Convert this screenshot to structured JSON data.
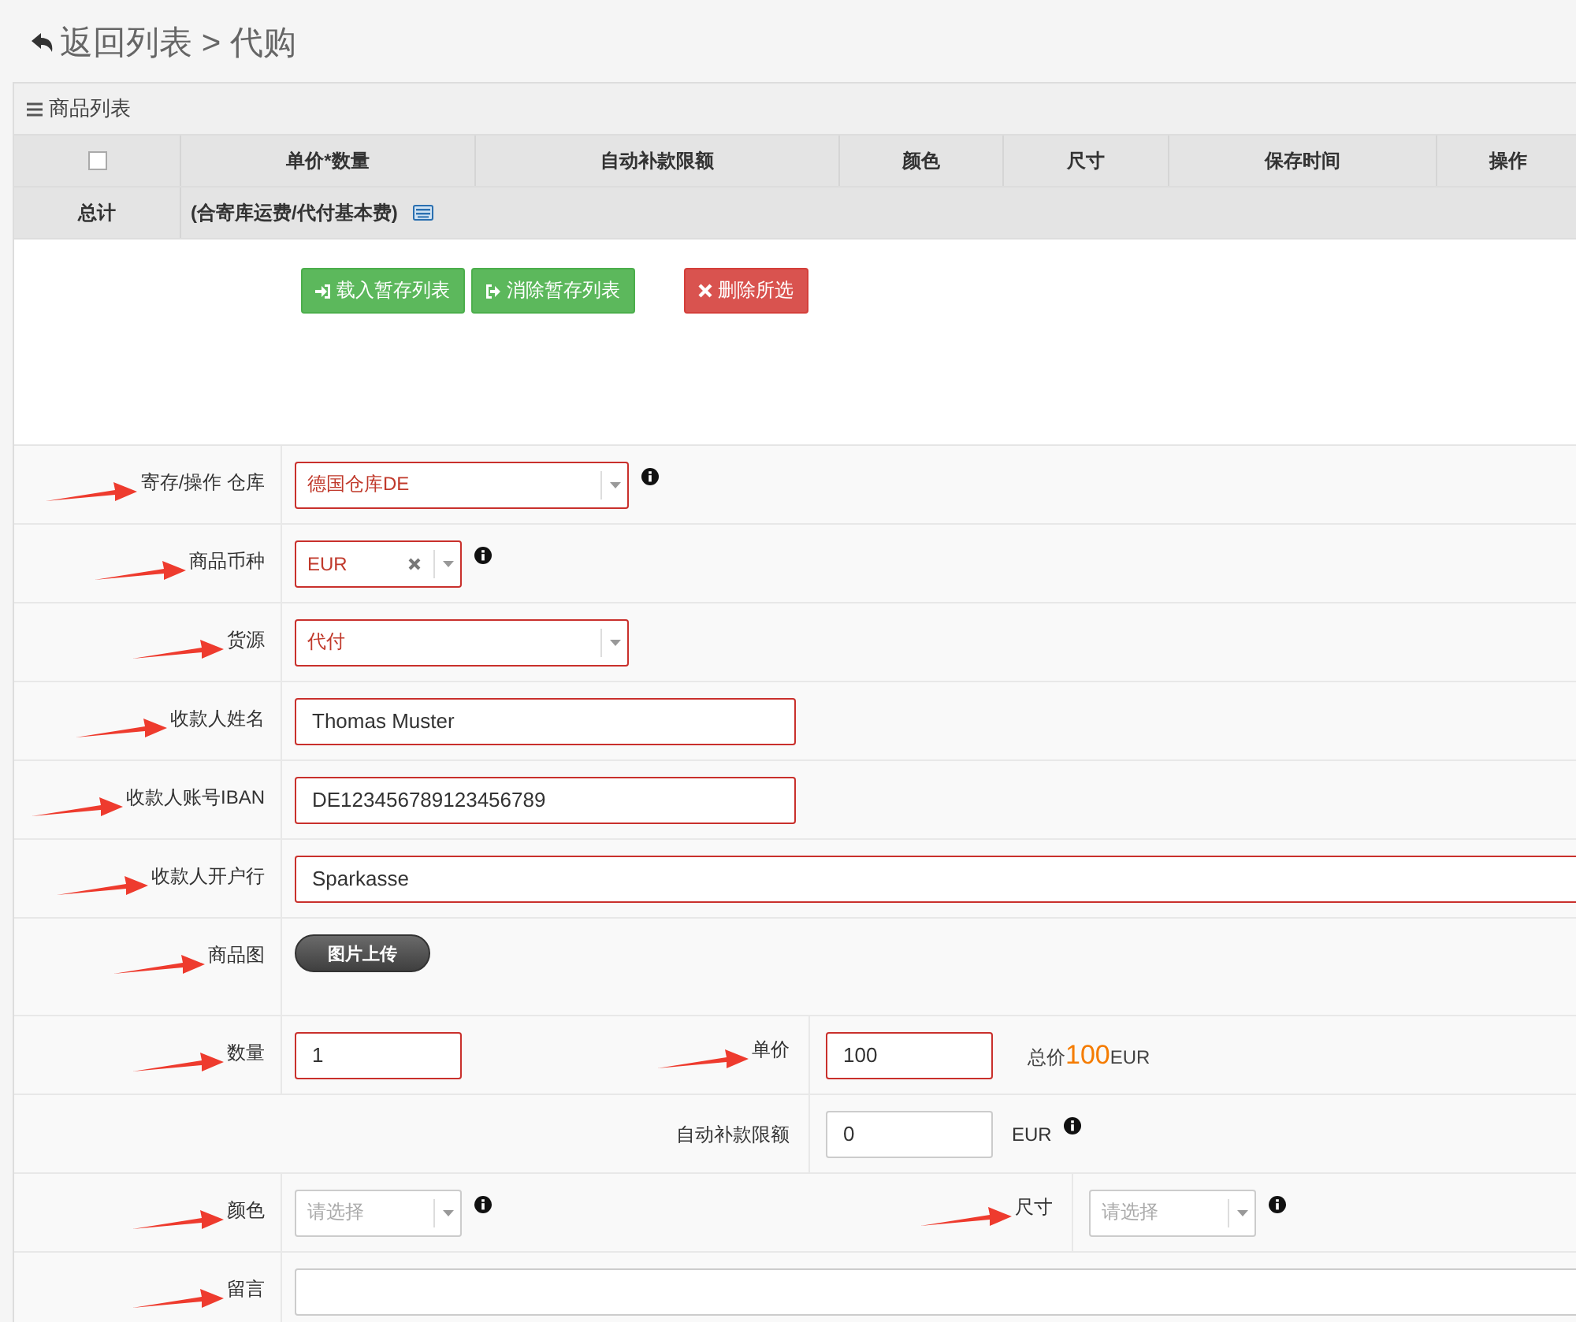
{
  "breadcrumb": {
    "text": "返回列表 > 代购"
  },
  "panel": {
    "title": "商品列表"
  },
  "table": {
    "select_all": {
      "checked": false
    },
    "columns": [
      "单价*数量",
      "自动补款限额",
      "颜色",
      "尺寸",
      "保存时间",
      "操作"
    ],
    "summary": {
      "label": "总计",
      "note": "(合寄库运费/代付基本费)"
    }
  },
  "buttons": [
    {
      "label": "载入暂存列表",
      "kind": "success"
    },
    {
      "label": "消除暂存列表",
      "kind": "success"
    },
    {
      "label": "删除所选",
      "kind": "danger"
    }
  ],
  "form": [
    {
      "kind": "field",
      "label": "寄存/操作 仓库",
      "annotated": true,
      "control": {
        "kind": "select",
        "value": "德国仓库DE",
        "error": true,
        "info": true,
        "clearable": false
      }
    },
    {
      "kind": "field",
      "label": "商品币种",
      "annotated": true,
      "control": {
        "kind": "select",
        "value": "EUR",
        "error": true,
        "info": true,
        "clearable": true
      }
    },
    {
      "kind": "field",
      "label": "货源",
      "annotated": true,
      "control": {
        "kind": "select",
        "value": "代付",
        "error": true,
        "info": false,
        "clearable": false
      }
    },
    {
      "kind": "field",
      "label": "收款人姓名",
      "annotated": true,
      "control": {
        "kind": "input",
        "value": "Thomas Muster",
        "error": true
      }
    },
    {
      "kind": "field",
      "label": "收款人账号IBAN",
      "annotated": true,
      "control": {
        "kind": "input",
        "value": "DE123456789123456789",
        "error": true
      }
    },
    {
      "kind": "field",
      "label": "收款人开户行",
      "annotated": true,
      "control": {
        "kind": "input",
        "value": "Sparkasse",
        "error": true
      }
    },
    {
      "kind": "upload",
      "label": "商品图",
      "annotated": true,
      "control": {
        "kind": "button",
        "value": "图片上传"
      }
    },
    {
      "kind": "pair",
      "label": "数量",
      "annotated": true,
      "control": {
        "kind": "input",
        "value": "1",
        "error": true
      },
      "label2": "单价",
      "annotated2": true,
      "control2": {
        "kind": "input",
        "value": "100",
        "error": true
      },
      "total": {
        "label": "总价",
        "amount": "100",
        "currency": "EUR"
      }
    },
    {
      "kind": "offset",
      "label": "自动补款限额",
      "annotated": false,
      "control": {
        "kind": "input",
        "value": "0",
        "error": false
      },
      "suffix": "EUR",
      "info": true
    },
    {
      "kind": "pair_select",
      "label": "颜色",
      "annotated": true,
      "control": {
        "kind": "select",
        "placeholder": "请选择",
        "error": false,
        "info": true,
        "clearable": false
      },
      "label2": "尺寸",
      "annotated2": true,
      "control2": {
        "kind": "select",
        "placeholder": "请选择",
        "error": false,
        "info": true,
        "clearable": false
      }
    },
    {
      "kind": "field",
      "label": "留言",
      "annotated": true,
      "control": {
        "kind": "input",
        "error": false
      }
    }
  ]
}
